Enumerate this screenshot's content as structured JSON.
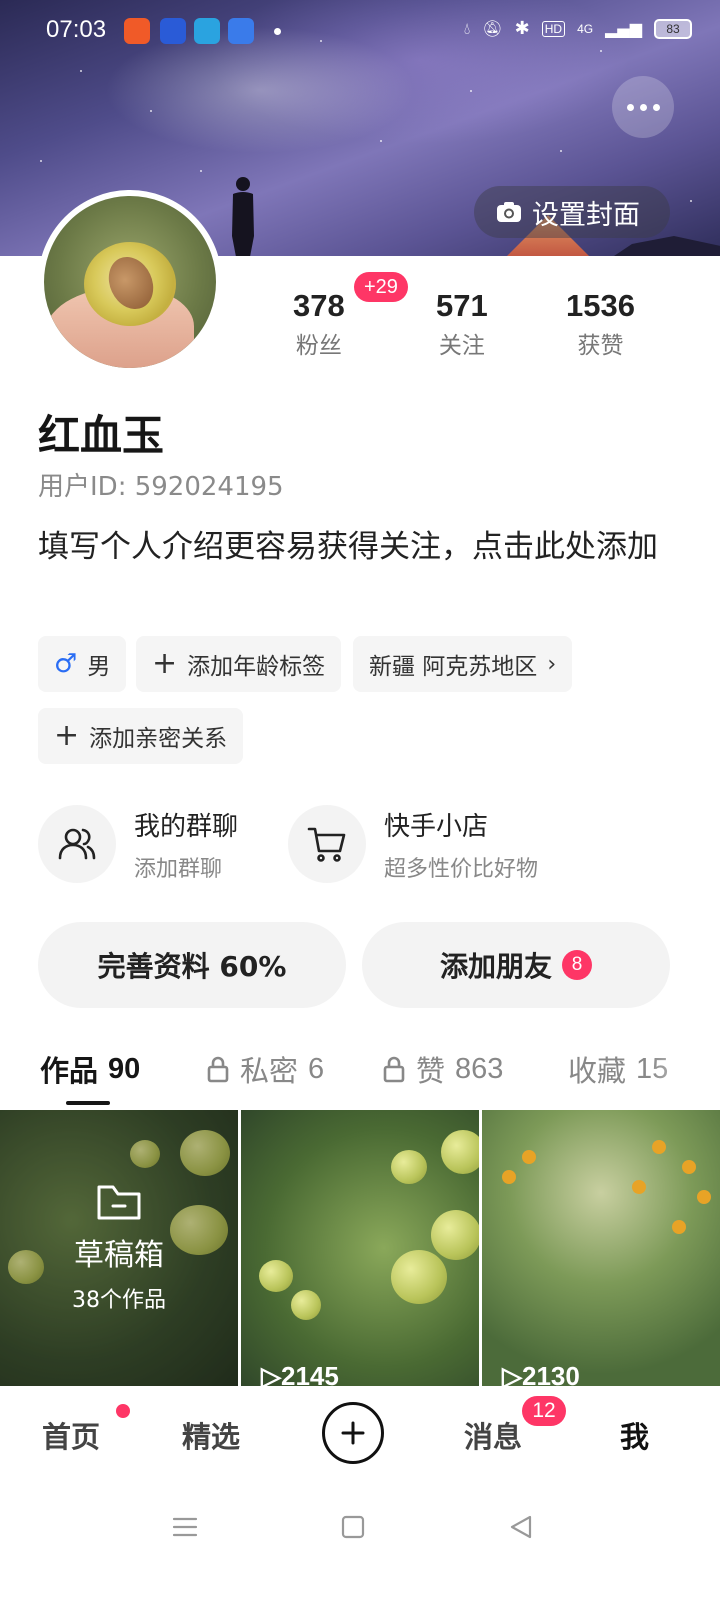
{
  "status_bar": {
    "time": "07:03",
    "network": "4G",
    "hd_label": "HD",
    "battery": "83",
    "app_icons": [
      "baidu-map-icon",
      "baidu-app-icon",
      "telegram-icon",
      "chat-icon"
    ]
  },
  "cover": {
    "set_cover_label": "设置封面"
  },
  "profile": {
    "followers_count": "378",
    "followers_label": "粉丝",
    "followers_delta": "+29",
    "following_count": "571",
    "following_label": "关注",
    "likes_count": "1536",
    "likes_label": "获赞",
    "name": "红血玉",
    "user_id": "用户ID: 592024195",
    "bio": "填写个人介绍更容易获得关注，点击此处添加"
  },
  "tags": {
    "gender": "男",
    "add_age": "添加年龄标签",
    "location": "新疆 阿克苏地区",
    "add_relation": "添加亲密关系"
  },
  "features": {
    "group_chat_title": "我的群聊",
    "group_chat_sub": "添加群聊",
    "shop_title": "快手小店",
    "shop_sub": "超多性价比好物"
  },
  "actions": {
    "complete_profile": "完善资料 60%",
    "complete_profile_percent": 60,
    "add_friends": "添加朋友",
    "add_friends_badge": "8"
  },
  "tabs": {
    "works_label": "作品",
    "works_count": "90",
    "private_label": "私密",
    "private_count": "6",
    "liked_label": "赞",
    "liked_count": "863",
    "favorites_label": "收藏",
    "favorites_count": "15"
  },
  "grid": {
    "draft_title": "草稿箱",
    "draft_count": "38个作品",
    "video2_plays": "2145",
    "video3_plays": "2130"
  },
  "bottom_nav": {
    "home": "首页",
    "featured": "精选",
    "messages": "消息",
    "messages_badge": "12",
    "me": "我"
  },
  "colors": {
    "accent": "#fe3666",
    "gender_blue": "#2a6df4"
  }
}
